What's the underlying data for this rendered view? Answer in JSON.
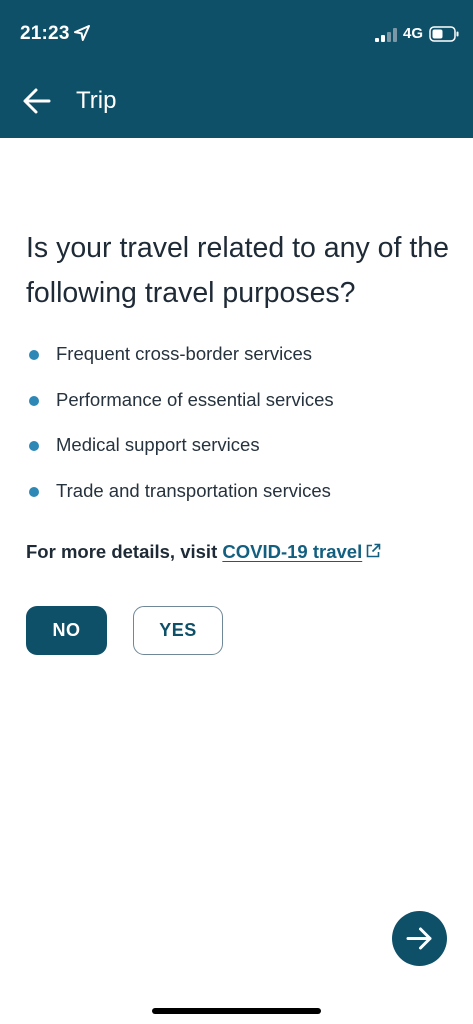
{
  "status_bar": {
    "time": "21:23",
    "network": "4G"
  },
  "header": {
    "title": "Trip"
  },
  "question": "Is your travel related to any of the following travel purposes?",
  "purposes": [
    "Frequent cross-border services",
    "Performance of essential services",
    "Medical support services",
    "Trade and transportation services"
  ],
  "details": {
    "prefix": "For more details, visit ",
    "link_label": "COVID-19 travel"
  },
  "buttons": {
    "no_label": "NO",
    "yes_label": "YES",
    "selected": "NO"
  },
  "icons": {
    "back": "back-arrow-icon",
    "location": "location-arrow-icon",
    "external": "external-link-icon",
    "next": "arrow-right-icon",
    "signal": "cellular-signal-icon",
    "battery": "battery-icon"
  },
  "colors": {
    "header_bg": "#0f5069",
    "bullet": "#2d88b5",
    "link": "#135f7f",
    "primary_button": "#0f5069"
  }
}
